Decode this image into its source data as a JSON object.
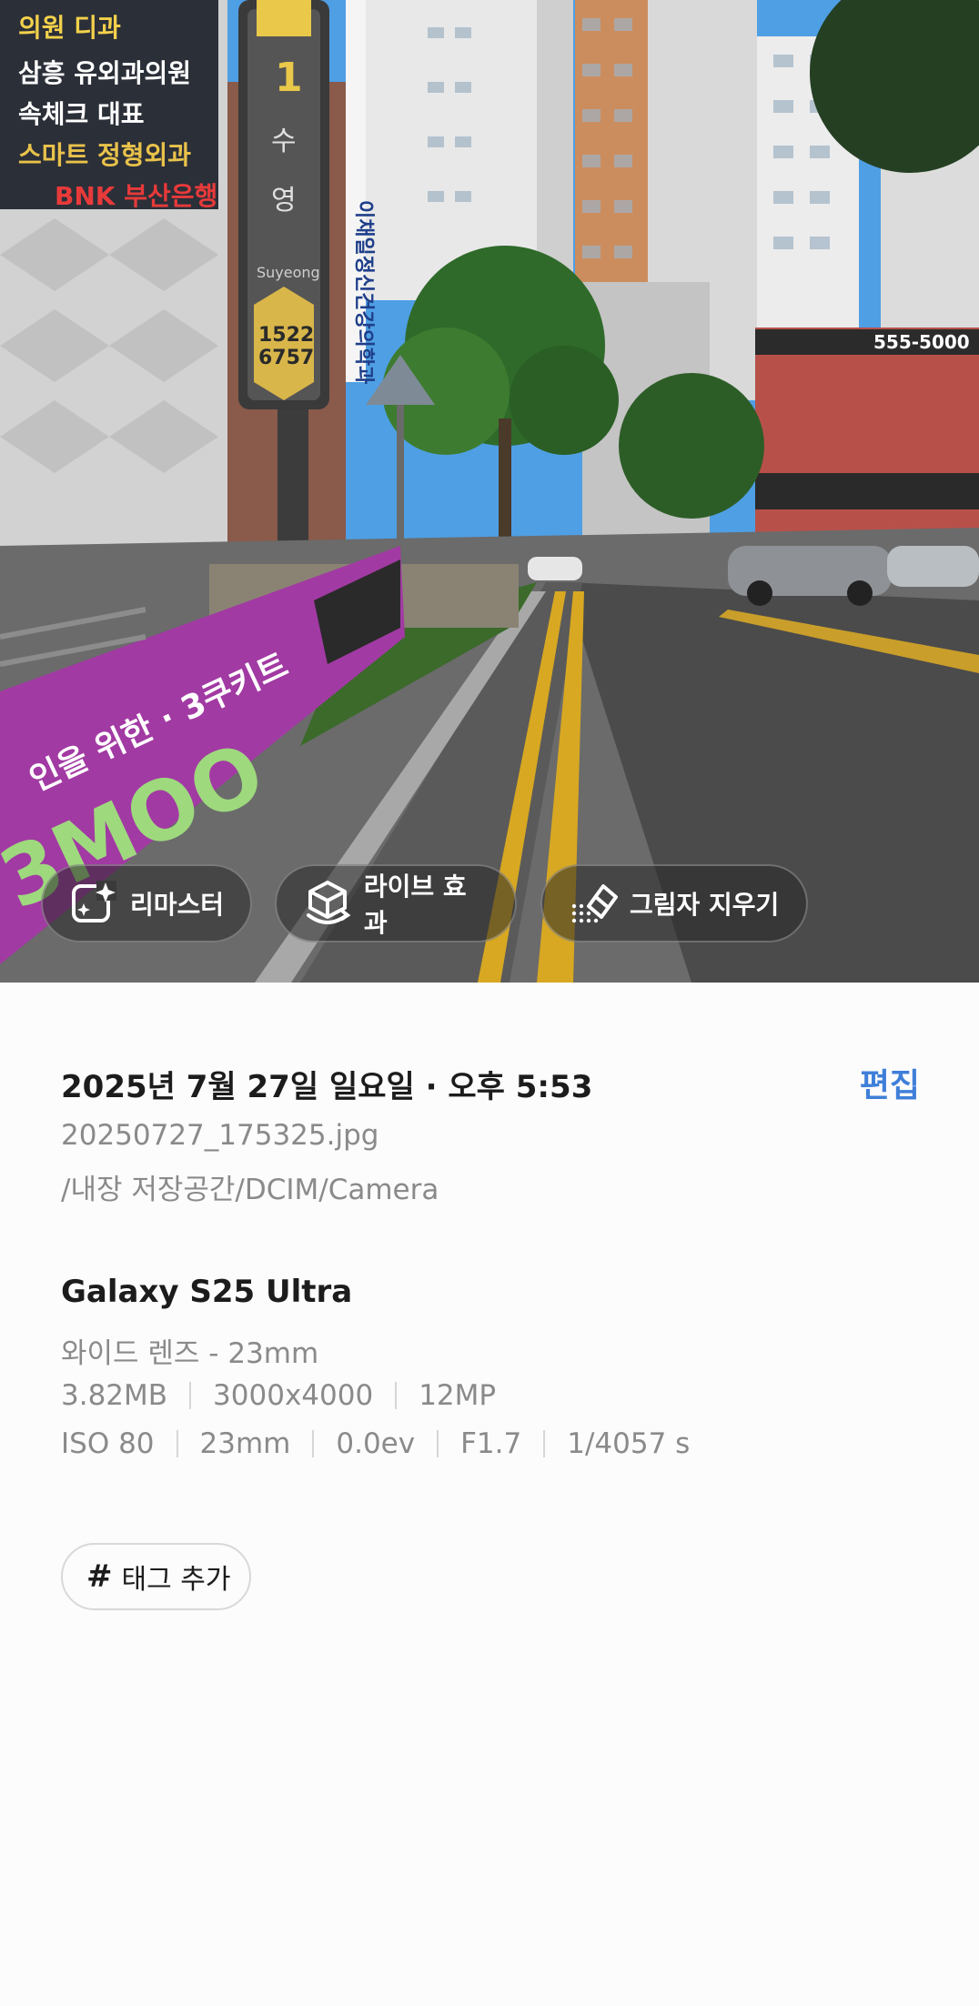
{
  "photo": {
    "signs": {
      "station_number": "1",
      "station_name_1": "수",
      "station_name_2": "영",
      "station_roman": "Suyeong",
      "phone_1": "1522",
      "phone_2": "6757",
      "billboard": "555-5000"
    },
    "actions": [
      {
        "label": "리마스터",
        "icon": "sparkle-remaster-icon"
      },
      {
        "label": "라이브 효과",
        "icon": "live-effect-cube-icon"
      },
      {
        "label": "그림자 지우기",
        "icon": "eraser-shadow-icon"
      }
    ]
  },
  "info": {
    "date_title": "2025년 7월 27일 일요일 · 오후 5:53",
    "edit_label": "편집",
    "filename": "20250727_175325.jpg",
    "path": "/내장 저장공간/DCIM/Camera",
    "device": "Galaxy S25 Ultra",
    "lens": "와이드 렌즈 - 23mm",
    "file_row": [
      "3.82MB",
      "3000x4000",
      "12MP"
    ],
    "exif_row": [
      "ISO 80",
      "23mm",
      "0.0ev",
      "F1.7",
      "1/4057 s"
    ],
    "tag_button": {
      "hash": "#",
      "label": "태그 추가"
    }
  },
  "colors": {
    "accent": "#3f7fd9",
    "banner": "#a23aa3",
    "secondary_text": "#8a8a8a"
  }
}
